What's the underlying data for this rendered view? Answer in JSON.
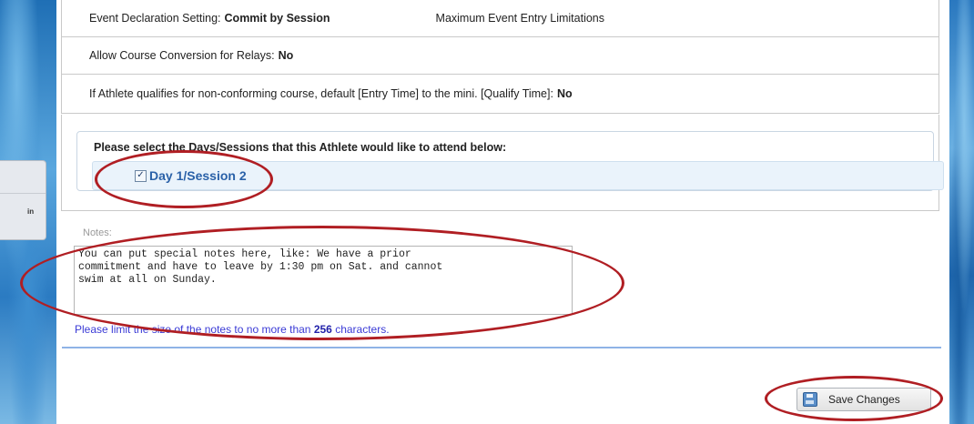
{
  "settings": {
    "event_declaration_label": "Event Declaration Setting:",
    "event_declaration_value": "Commit by Session",
    "max_entry_label": "Maximum Event Entry Limitations",
    "course_conversion_label": "Allow Course Conversion for Relays:",
    "course_conversion_value": "No",
    "nonconforming_label": "If Athlete qualifies for non-conforming course, default [Entry Time] to the mini. [Qualify Time]:",
    "nonconforming_value": "No"
  },
  "sessions": {
    "title": "Please select the Days/Sessions that this Athlete would like to attend below:",
    "items": [
      {
        "label": "Day 1/Session 2",
        "checked": true
      }
    ]
  },
  "notes": {
    "label": "Notes:",
    "value": "You can put special notes here, like: We have a prior\ncommitment and have to leave by 1:30 pm on Sat. and cannot\nswim at all on Sunday.",
    "hint_prefix": "Please limit the size of the notes to no more than",
    "hint_limit": "256",
    "hint_suffix": "characters."
  },
  "left_tab": {
    "text": "in"
  },
  "buttons": {
    "save_label": "Save Changes",
    "save_icon": "floppy-disk-icon"
  },
  "colors": {
    "annotation": "#b01e23",
    "session_text": "#2a61a8",
    "hint_text": "#3b3bd6",
    "divider": "#8fb3e6"
  }
}
